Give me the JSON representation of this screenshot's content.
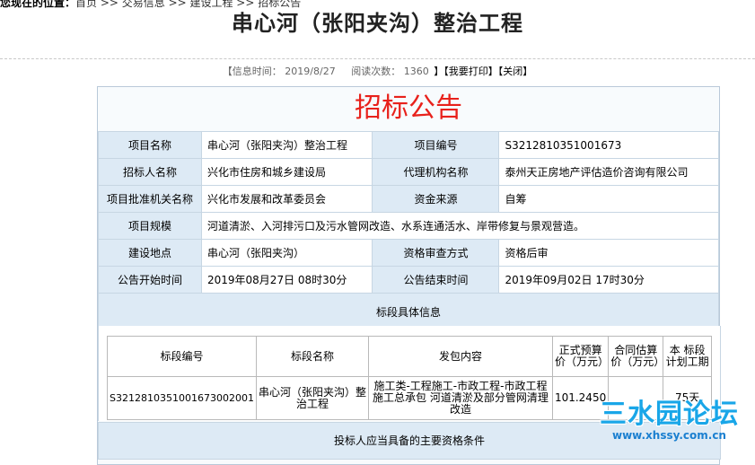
{
  "breadcrumb": {
    "lead": "您现在的位置：",
    "path": "首页 >> 交易信息 >> 建设工程 >> 招标公告"
  },
  "page_title": "串心河（张阳夹沟）整治工程",
  "meta": {
    "time_label": "【信息时间：",
    "time_value": "2019/8/27",
    "views_label": "阅读次数：",
    "views_value": "1360",
    "print_label": "】【我要打印】",
    "close_label": "【关闭】"
  },
  "notice_title": "招标公告",
  "fields": {
    "project_name": {
      "label": "项目名称",
      "value": "串心河（张阳夹沟）整治工程"
    },
    "project_no": {
      "label": "项目编号",
      "value": "S3212810351001673"
    },
    "tenderer": {
      "label": "招标人名称",
      "value": "兴化市住房和城乡建设局"
    },
    "agency": {
      "label": "代理机构名称",
      "value": "泰州天正房地产评估造价咨询有限公司"
    },
    "approval": {
      "label": "项目批准机关名称",
      "value": "兴化市发展和改革委员会"
    },
    "funding": {
      "label": "资金来源",
      "value": "自筹"
    },
    "scale": {
      "label": "项目规模",
      "value": "河道清淤、入河排污口及污水管网改造、水系连通活水、岸带修复与景观营造。"
    },
    "location": {
      "label": "建设地点",
      "value": "串心河（张阳夹沟）"
    },
    "review": {
      "label": "资格审查方式",
      "value": "资格后审"
    },
    "start": {
      "label": "公告开始时间",
      "value": "2019年08月27日 08时30分"
    },
    "end": {
      "label": "公告结束时间",
      "value": "2019年09月02日 17时30分"
    }
  },
  "section_info": "标段具体信息",
  "lots": {
    "headers": [
      "标段编号",
      "标段名称",
      "发包内容",
      "正式预算价（万元）",
      "合同估算价（万元）",
      "本 标段计划工期"
    ],
    "rows": [
      [
        "S3212810351001673002001",
        "串心河（张阳夹沟）整治工程",
        "施工类-工程施工-市政工程-市政工程施工总承包  河道清淤及部分管网清理改造",
        "101.2450",
        "",
        "75天"
      ]
    ]
  },
  "section_qual": "投标人应当具备的主要资格条件",
  "watermark": {
    "text": "三水园论坛",
    "url": "www.xhssy.com.cn"
  }
}
